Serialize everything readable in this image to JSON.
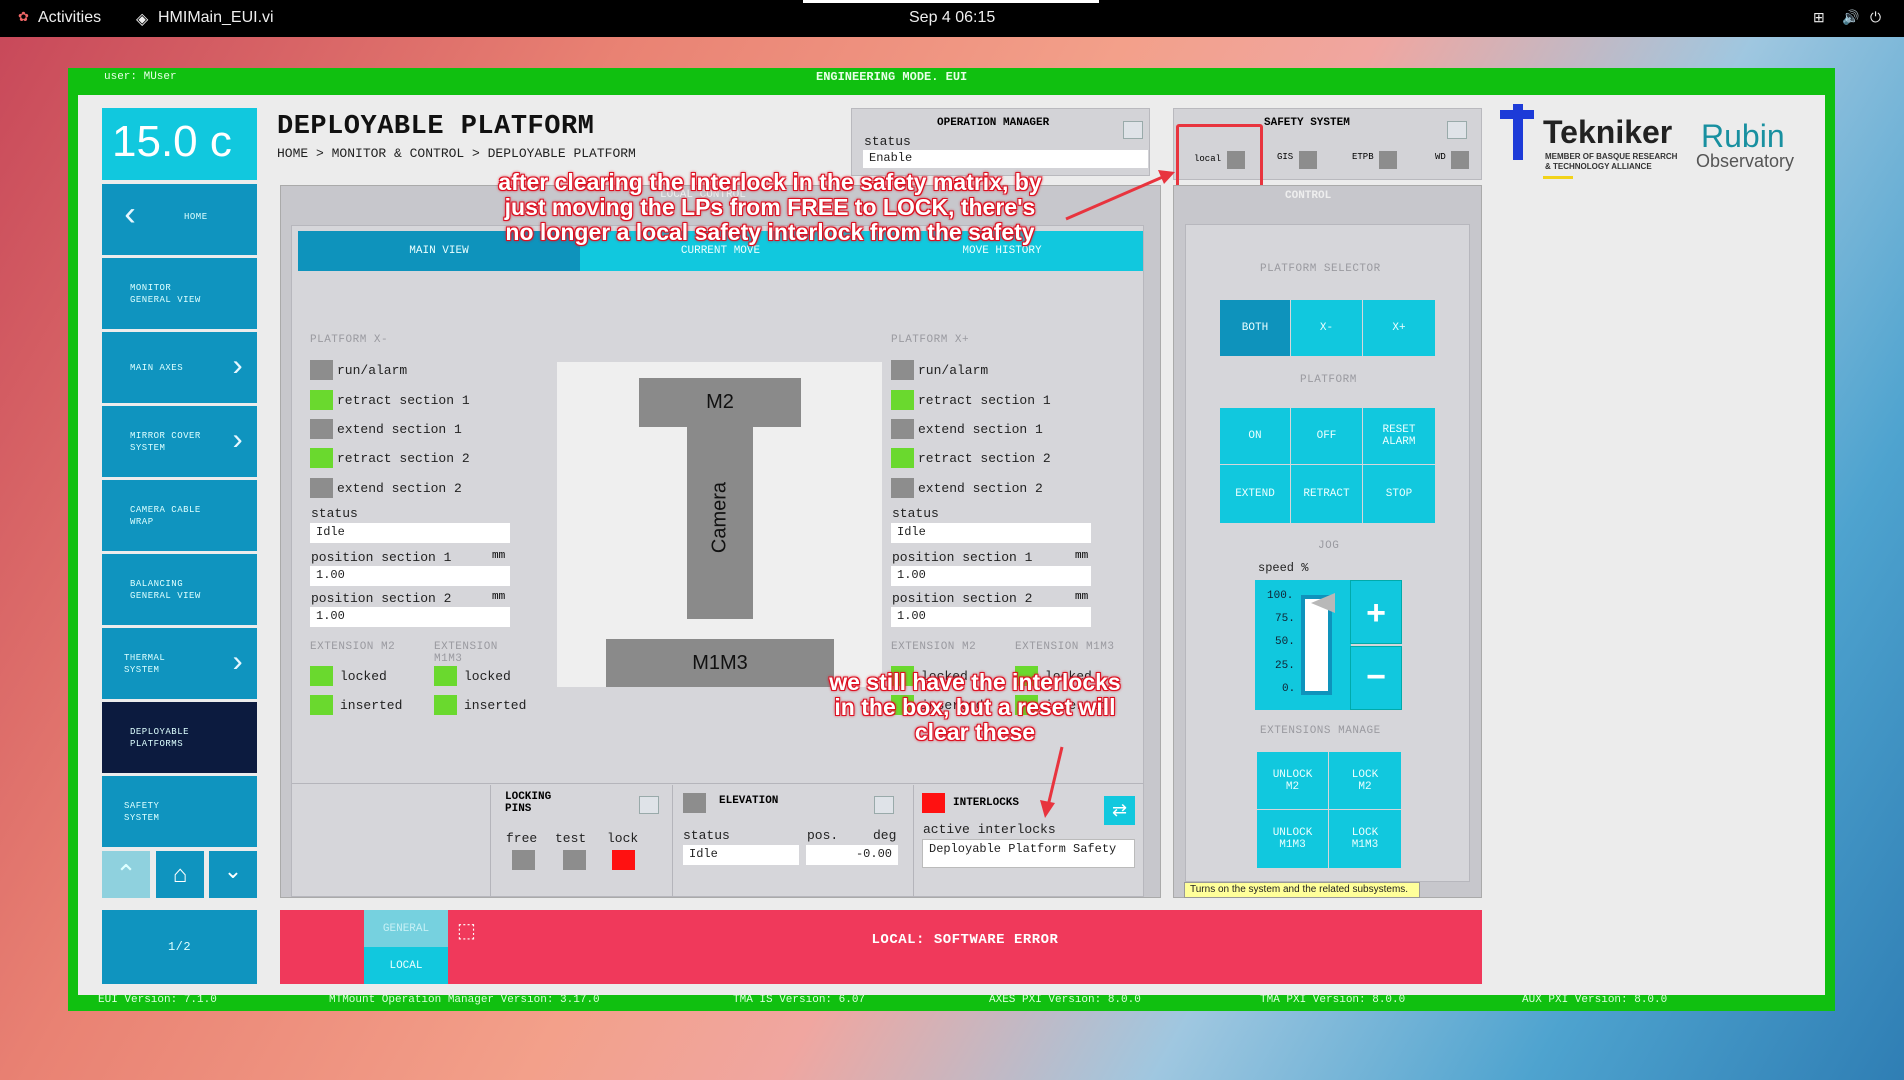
{
  "topbar": {
    "activities": "Activities",
    "app": "HMIMain_EUI.vi",
    "clock": "Sep 4  06:15"
  },
  "header": {
    "user": "user: MUser",
    "mode": "ENGINEERING MODE. EUI"
  },
  "temperature": "15.0 c",
  "page": {
    "title": "DEPLOYABLE PLATFORM",
    "breadcrumb": "HOME > MONITOR & CONTROL > DEPLOYABLE PLATFORM"
  },
  "sidebar": {
    "items": [
      {
        "label": "HOME"
      },
      {
        "label": "MONITOR\nGENERAL VIEW"
      },
      {
        "label": "MAIN AXES"
      },
      {
        "label": "MIRROR COVER\nSYSTEM"
      },
      {
        "label": "CAMERA CABLE\nWRAP"
      },
      {
        "label": "BALANCING\nGENERAL VIEW"
      },
      {
        "label": "THERMAL\nSYSTEM"
      },
      {
        "label": "DEPLOYABLE\nPLATFORMS"
      },
      {
        "label": "SAFETY\nSYSTEM"
      }
    ],
    "pager": "1/2"
  },
  "opmanager": {
    "title": "OPERATION MANAGER",
    "status_label": "status",
    "status_value": "Enable"
  },
  "safety": {
    "title": "SAFETY SYSTEM",
    "items": [
      "local",
      "GIS",
      "ETPB",
      "WD"
    ],
    "control": "CONTROL"
  },
  "tabs": [
    "MAIN VIEW",
    "CURRENT MOVE",
    "MOVE HISTORY"
  ],
  "control_hidden_label": "LOCAL CONTROL",
  "platform_x_minus": {
    "title": "PLATFORM X-",
    "signals": [
      "run/alarm",
      "retract section 1",
      "extend section 1",
      "retract section 2",
      "extend section 2"
    ],
    "status_label": "status",
    "status": "Idle",
    "pos1_label": "position section 1",
    "pos2_label": "position section 2",
    "unit": "mm",
    "pos1": "1.00",
    "pos2": "1.00",
    "ext_m2": "EXTENSION M2",
    "ext_m1m3": "EXTENSION M1M3",
    "locked": "locked",
    "inserted": "inserted"
  },
  "platform_x_plus": {
    "title": "PLATFORM X+",
    "signals": [
      "run/alarm",
      "retract section 1",
      "extend section 1",
      "retract section 2",
      "extend section 2"
    ],
    "status_label": "status",
    "status": "Idle",
    "pos1_label": "position section 1",
    "pos2_label": "position section 2",
    "unit": "mm",
    "pos1": "1.00",
    "pos2": "1.00",
    "ext_m2": "EXTENSION M2",
    "ext_m1m3": "EXTENSION M1M3",
    "locked": "locked",
    "inserted": "inserted"
  },
  "diagram": {
    "m2": "M2",
    "camera": "Camera",
    "m1m3": "M1M3"
  },
  "locking": {
    "title": "LOCKING\nPINS",
    "free": "free",
    "test": "test",
    "lock": "lock"
  },
  "elevation": {
    "title": "ELEVATION",
    "status_label": "status",
    "pos_label": "pos.",
    "unit": "deg",
    "status": "Idle",
    "pos": "-0.00"
  },
  "interlocks": {
    "title": "INTERLOCKS",
    "active_label": "active interlocks",
    "value": "Deployable Platform Safety"
  },
  "control": {
    "selector_title": "PLATFORM SELECTOR",
    "selector": [
      "BOTH",
      "X-",
      "X+"
    ],
    "platform_title": "PLATFORM",
    "platform_buttons": [
      "ON",
      "OFF",
      "RESET\nALARM",
      "EXTEND",
      "RETRACT",
      "STOP"
    ],
    "jog_title": "JOG",
    "speed_label": "speed %",
    "scale": [
      "100.",
      "75.",
      "50.",
      "25.",
      "0."
    ],
    "plus": "+",
    "minus": "−",
    "ext_title": "EXTENSIONS MANAGE",
    "ext_buttons": [
      "UNLOCK\nM2",
      "LOCK\nM2",
      "UNLOCK\nM1M3",
      "LOCK\nM1M3"
    ],
    "tooltip": "Turns on the system and the related subsystems.",
    "speed_fraction": 1.0
  },
  "bottom": {
    "general": "GENERAL",
    "local": "LOCAL",
    "message": "LOCAL: SOFTWARE ERROR"
  },
  "footer": [
    "EUI Version: 7.1.0",
    "MTMount Operation Manager Version: 3.17.0",
    "TMA IS Version: 6.07",
    "AXES PXI Version: 8.0.0",
    "TMA PXI Version: 8.0.0",
    "AUX PXI Version: 8.0.0"
  ],
  "logos": {
    "tekniker": "Tekniker",
    "tekniker_sub": "MEMBER OF BASQUE RESEARCH\n& TECHNOLOGY ALLIANCE",
    "rubin1": "Rubin",
    "rubin2": "Observatory"
  },
  "annotations": {
    "a1": "after clearing the interlock in the safety matrix, by\njust moving the LPs from FREE to LOCK, there's\nno longer a local safety interlock from the safety",
    "a2": "we still have the interlocks\nin the box, but a reset will\nclear these"
  },
  "colors": {
    "accent": "#11c8de",
    "sidebar": "#0f94bf",
    "frame": "#10c010",
    "alarm": "#f0395b"
  }
}
